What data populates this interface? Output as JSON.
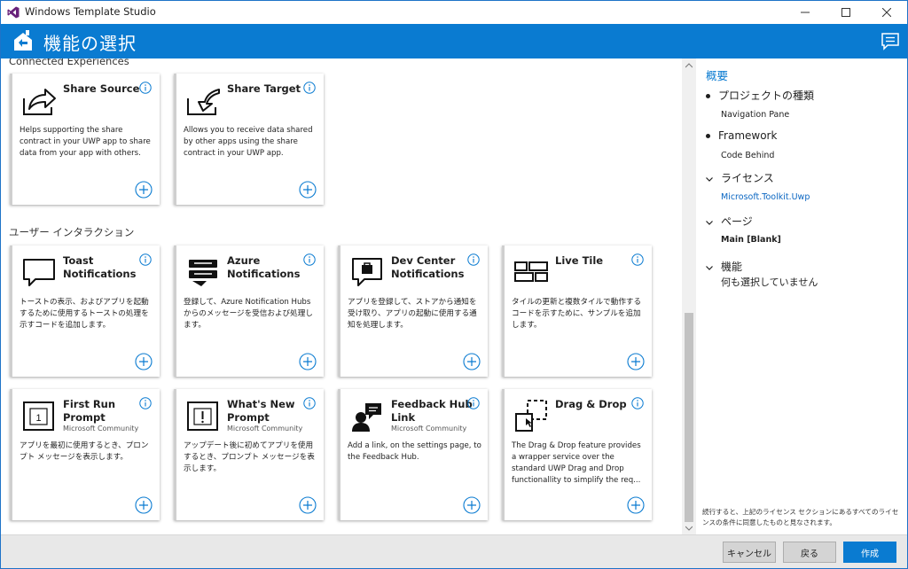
{
  "window": {
    "title": "Windows Template Studio",
    "brand_color": "#0A7BD1",
    "controls": [
      "minimize-icon",
      "maximize-icon",
      "close-icon"
    ]
  },
  "header": {
    "title": "機能の選択",
    "feedback_icon": "feedback-icon"
  },
  "sections": [
    {
      "title": "Connected Experiences",
      "cards": [
        {
          "name": "Share Source",
          "author": "",
          "icon": "share-source-icon",
          "description": "Helps supporting the share contract in your UWP app to share data from your app with others."
        },
        {
          "name": "Share Target",
          "author": "",
          "icon": "share-target-icon",
          "description": "Allows you to receive data shared by other apps using the share contract in your UWP app."
        }
      ]
    },
    {
      "title": "ユーザー インタラクション",
      "cards": [
        {
          "name": "Toast Notifications",
          "author": "",
          "icon": "toast-icon",
          "description": "トーストの表示、およびアプリを起動するために使用するトーストの処理を示すコードを追加します。"
        },
        {
          "name": "Azure Notifications",
          "author": "",
          "icon": "azure-notifications-icon",
          "description": "登録して、Azure Notification Hubs からのメッセージを受信および処理します。"
        },
        {
          "name": "Dev Center Notifications",
          "author": "",
          "icon": "dev-center-icon",
          "description": "アプリを登録して、ストアから通知を受け取り、アプリの起動に使用する通知を処理します。"
        },
        {
          "name": "Live Tile",
          "author": "",
          "icon": "live-tile-icon",
          "description": "タイルの更新と複数タイルで動作するコードを示すために、サンプルを追加します。"
        },
        {
          "name": "First Run Prompt",
          "author": "Microsoft Community",
          "icon": "first-run-icon",
          "description": "アプリを最初に使用するとき、プロンプト メッセージを表示します。"
        },
        {
          "name": "What's New Prompt",
          "author": "Microsoft Community",
          "icon": "whats-new-icon",
          "description": "アップデート後に初めてアプリを使用するとき、プロンプト メッセージを表示します。"
        },
        {
          "name": "Feedback Hub Link",
          "author": "Microsoft Community",
          "icon": "feedback-hub-icon",
          "description": "Add a link, on the settings page, to the Feedback Hub."
        },
        {
          "name": "Drag & Drop",
          "author": "",
          "icon": "drag-drop-icon",
          "description": "The Drag & Drop feature provides a wrapper service over the standard UWP Drag and Drop functionallity to simplify the req..."
        }
      ]
    }
  ],
  "summary": {
    "heading": "概要",
    "project_type_label": "プロジェクトの種類",
    "project_type_value": "Navigation Pane",
    "framework_label": "Framework",
    "framework_value": "Code Behind",
    "license_label": "ライセンス",
    "license_value": "Microsoft.Toolkit.Uwp",
    "pages_label": "ページ",
    "pages_value": "Main [Blank]",
    "features_label": "機能",
    "features_value": "何も選択していません",
    "terms": "続行すると、上記のライセンス セクションにあるすべてのライセンスの条件に同意したものと見なされます。"
  },
  "footer": {
    "cancel_label": "キャンセル",
    "back_label": "戻る",
    "create_label": "作成"
  }
}
